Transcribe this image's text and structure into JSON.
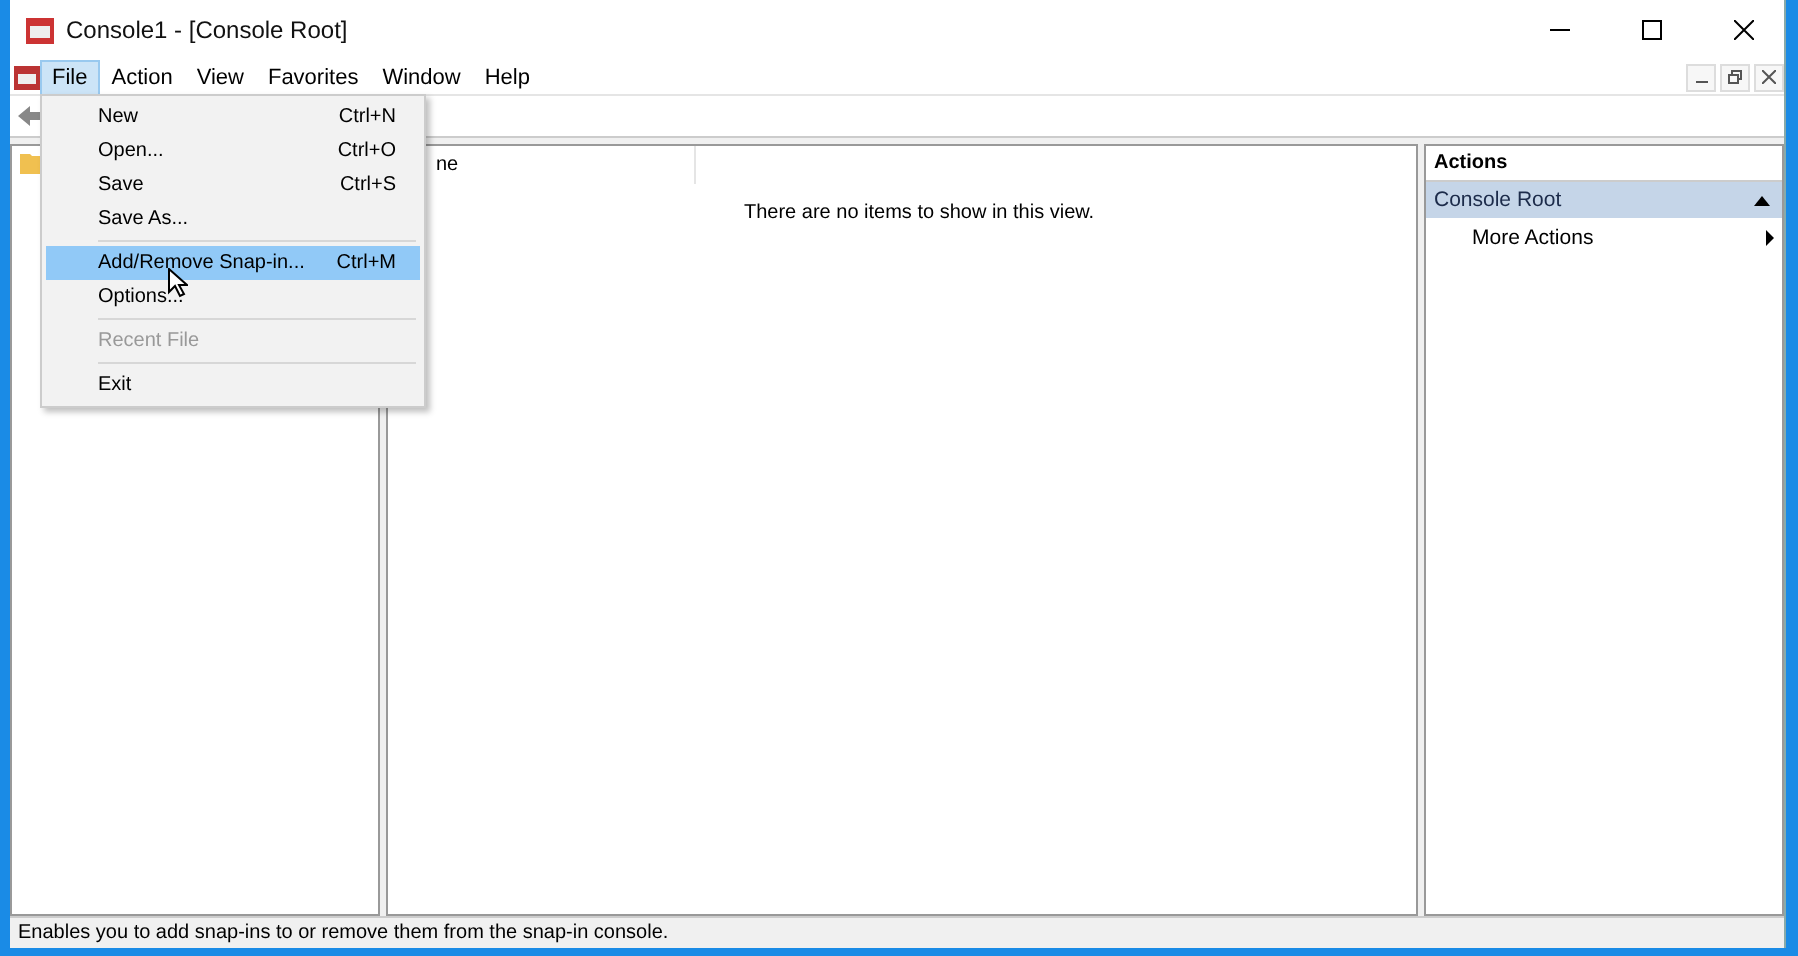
{
  "window": {
    "title": "Console1 - [Console Root]"
  },
  "menu_bar": [
    {
      "label": "File",
      "selected": true
    },
    {
      "label": "Action",
      "selected": false
    },
    {
      "label": "View",
      "selected": false
    },
    {
      "label": "Favorites",
      "selected": false
    },
    {
      "label": "Window",
      "selected": false
    },
    {
      "label": "Help",
      "selected": false
    }
  ],
  "file_menu": [
    {
      "kind": "item",
      "label": "New",
      "shortcut": "Ctrl+N",
      "selected": false,
      "disabled": false
    },
    {
      "kind": "item",
      "label": "Open...",
      "shortcut": "Ctrl+O",
      "selected": false,
      "disabled": false
    },
    {
      "kind": "item",
      "label": "Save",
      "shortcut": "Ctrl+S",
      "selected": false,
      "disabled": false
    },
    {
      "kind": "item",
      "label": "Save As...",
      "selected": false,
      "disabled": false
    },
    {
      "kind": "separator"
    },
    {
      "kind": "item",
      "label": "Add/Remove Snap-in...",
      "shortcut": "Ctrl+M",
      "selected": true,
      "disabled": false
    },
    {
      "kind": "item",
      "label": "Options...",
      "selected": false,
      "disabled": false
    },
    {
      "kind": "separator"
    },
    {
      "kind": "item",
      "label": "Recent File",
      "selected": false,
      "disabled": true
    },
    {
      "kind": "separator"
    },
    {
      "kind": "item",
      "label": "Exit",
      "selected": false,
      "disabled": false
    }
  ],
  "list_view": {
    "column_1": "ne",
    "empty_message": "There are no items to show in this view."
  },
  "actions_pane": {
    "title": "Actions",
    "section": "Console Root",
    "items": [
      "More Actions"
    ]
  },
  "status_bar": "Enables you to add snap-ins to or remove them from the snap-in console."
}
